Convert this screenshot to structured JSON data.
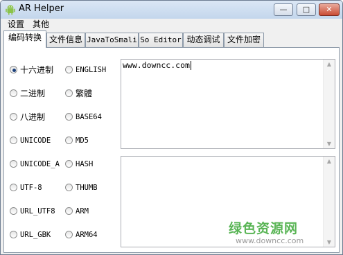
{
  "window": {
    "title": "AR Helper"
  },
  "controls": {
    "minimize": "—",
    "maximize": "□",
    "close": "✕"
  },
  "menu": [
    "设置",
    "其他"
  ],
  "tabs": [
    "编码转换",
    "文件信息",
    "JavaToSmali",
    "So Editor",
    "动态调试",
    "文件加密"
  ],
  "active_tab": 0,
  "encodings_left": [
    {
      "label": "十六进制",
      "selected": true
    },
    {
      "label": "二进制",
      "selected": false
    },
    {
      "label": "八进制",
      "selected": false
    },
    {
      "label": "UNICODE",
      "selected": false
    },
    {
      "label": "UNICODE_A",
      "selected": false
    },
    {
      "label": "UTF-8",
      "selected": false
    },
    {
      "label": "URL_UTF8",
      "selected": false
    },
    {
      "label": "URL_GBK",
      "selected": false
    }
  ],
  "encodings_right": [
    {
      "label": "ENGLISH",
      "selected": false
    },
    {
      "label": "繁體",
      "selected": false
    },
    {
      "label": "BASE64",
      "selected": false
    },
    {
      "label": "MD5",
      "selected": false
    },
    {
      "label": "HASH",
      "selected": false
    },
    {
      "label": "THUMB",
      "selected": false
    },
    {
      "label": "ARM",
      "selected": false
    },
    {
      "label": "ARM64",
      "selected": false
    }
  ],
  "input": {
    "value": "www.downcc.com"
  },
  "output": {
    "value": ""
  },
  "watermark": {
    "title": "绿色资源网",
    "url": "www.downcc.com"
  },
  "colors": {
    "watermark_green": "#5ab556",
    "selected_radio": "#1a3f7a",
    "title_bar": "#c3d6ec"
  }
}
